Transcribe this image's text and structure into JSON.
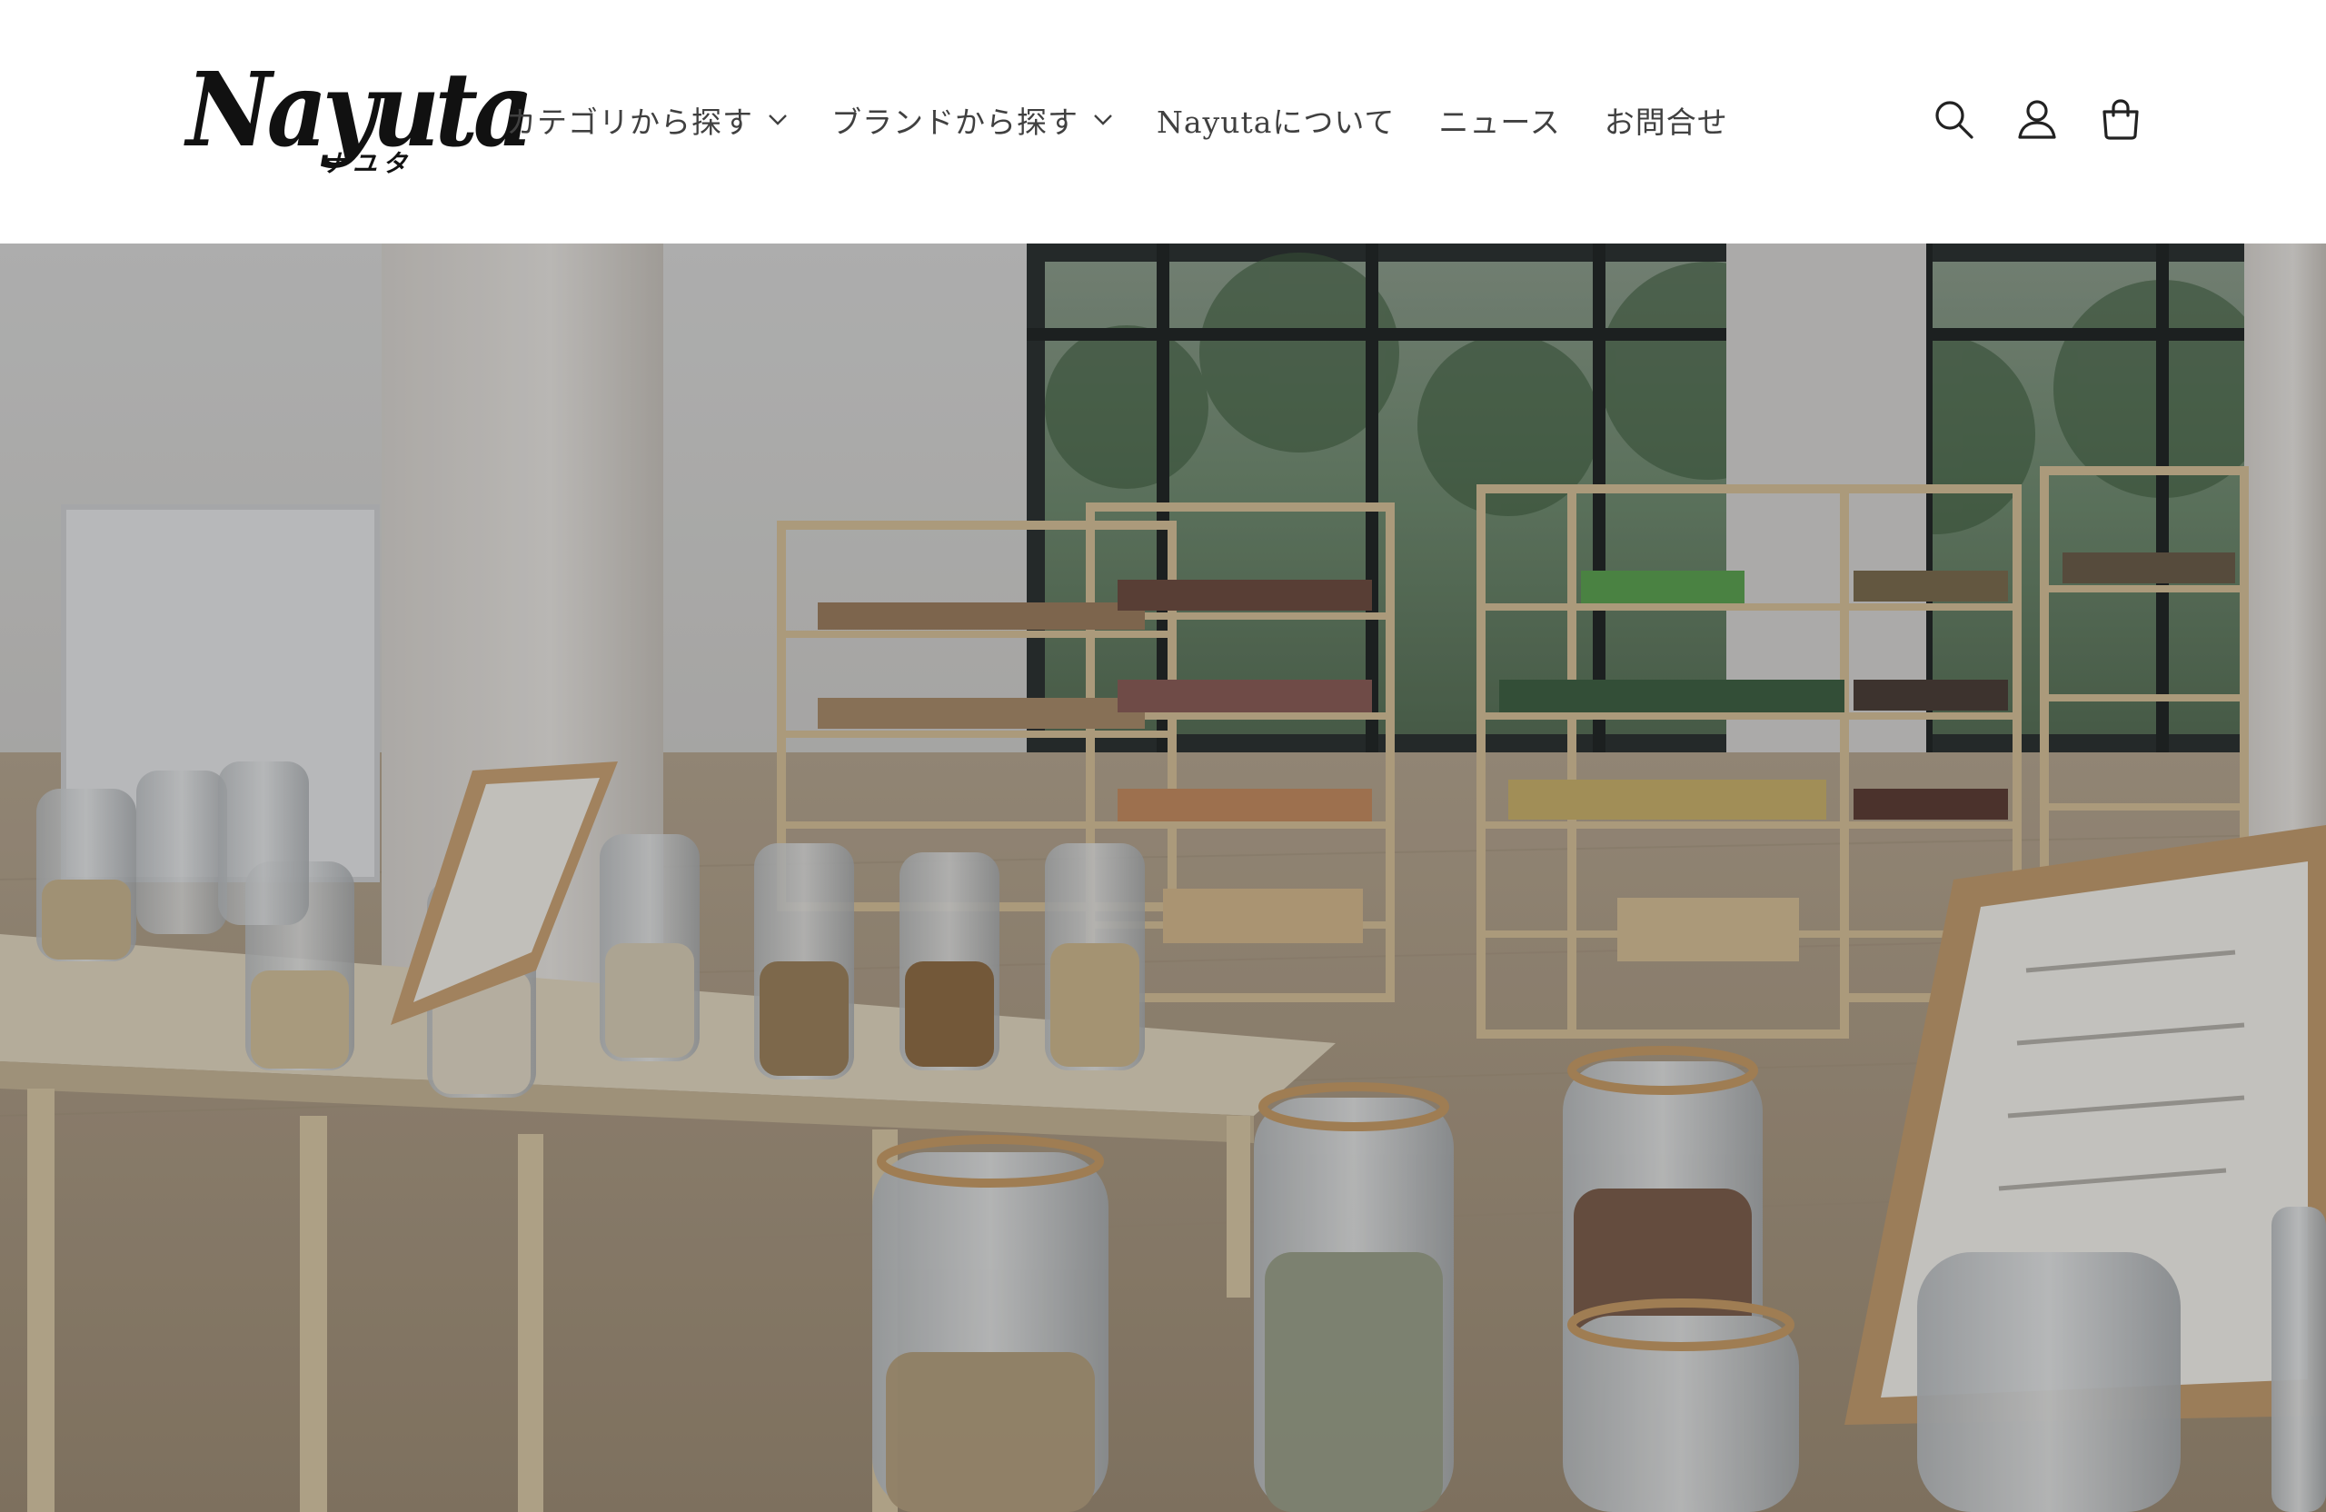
{
  "brand": {
    "logo_text": "Nayuta",
    "logo_kana": "ナユタ"
  },
  "nav": {
    "items": [
      {
        "label": "カテゴリから探す",
        "has_dropdown": true
      },
      {
        "label": "ブランドから探す",
        "has_dropdown": true
      },
      {
        "label": "Nayutaについて",
        "has_dropdown": false
      },
      {
        "label": "ニュース",
        "has_dropdown": false
      },
      {
        "label": "お問合せ",
        "has_dropdown": false
      }
    ]
  },
  "header_icons": [
    "search-icon",
    "account-icon",
    "cart-icon"
  ],
  "hero": {
    "image_subject": "bulk store interior with glass jars on wooden tables and shelving",
    "overlay_opacity": 0.22
  },
  "colors": {
    "text": "#404040",
    "logo": "#111111",
    "background": "#ffffff"
  }
}
